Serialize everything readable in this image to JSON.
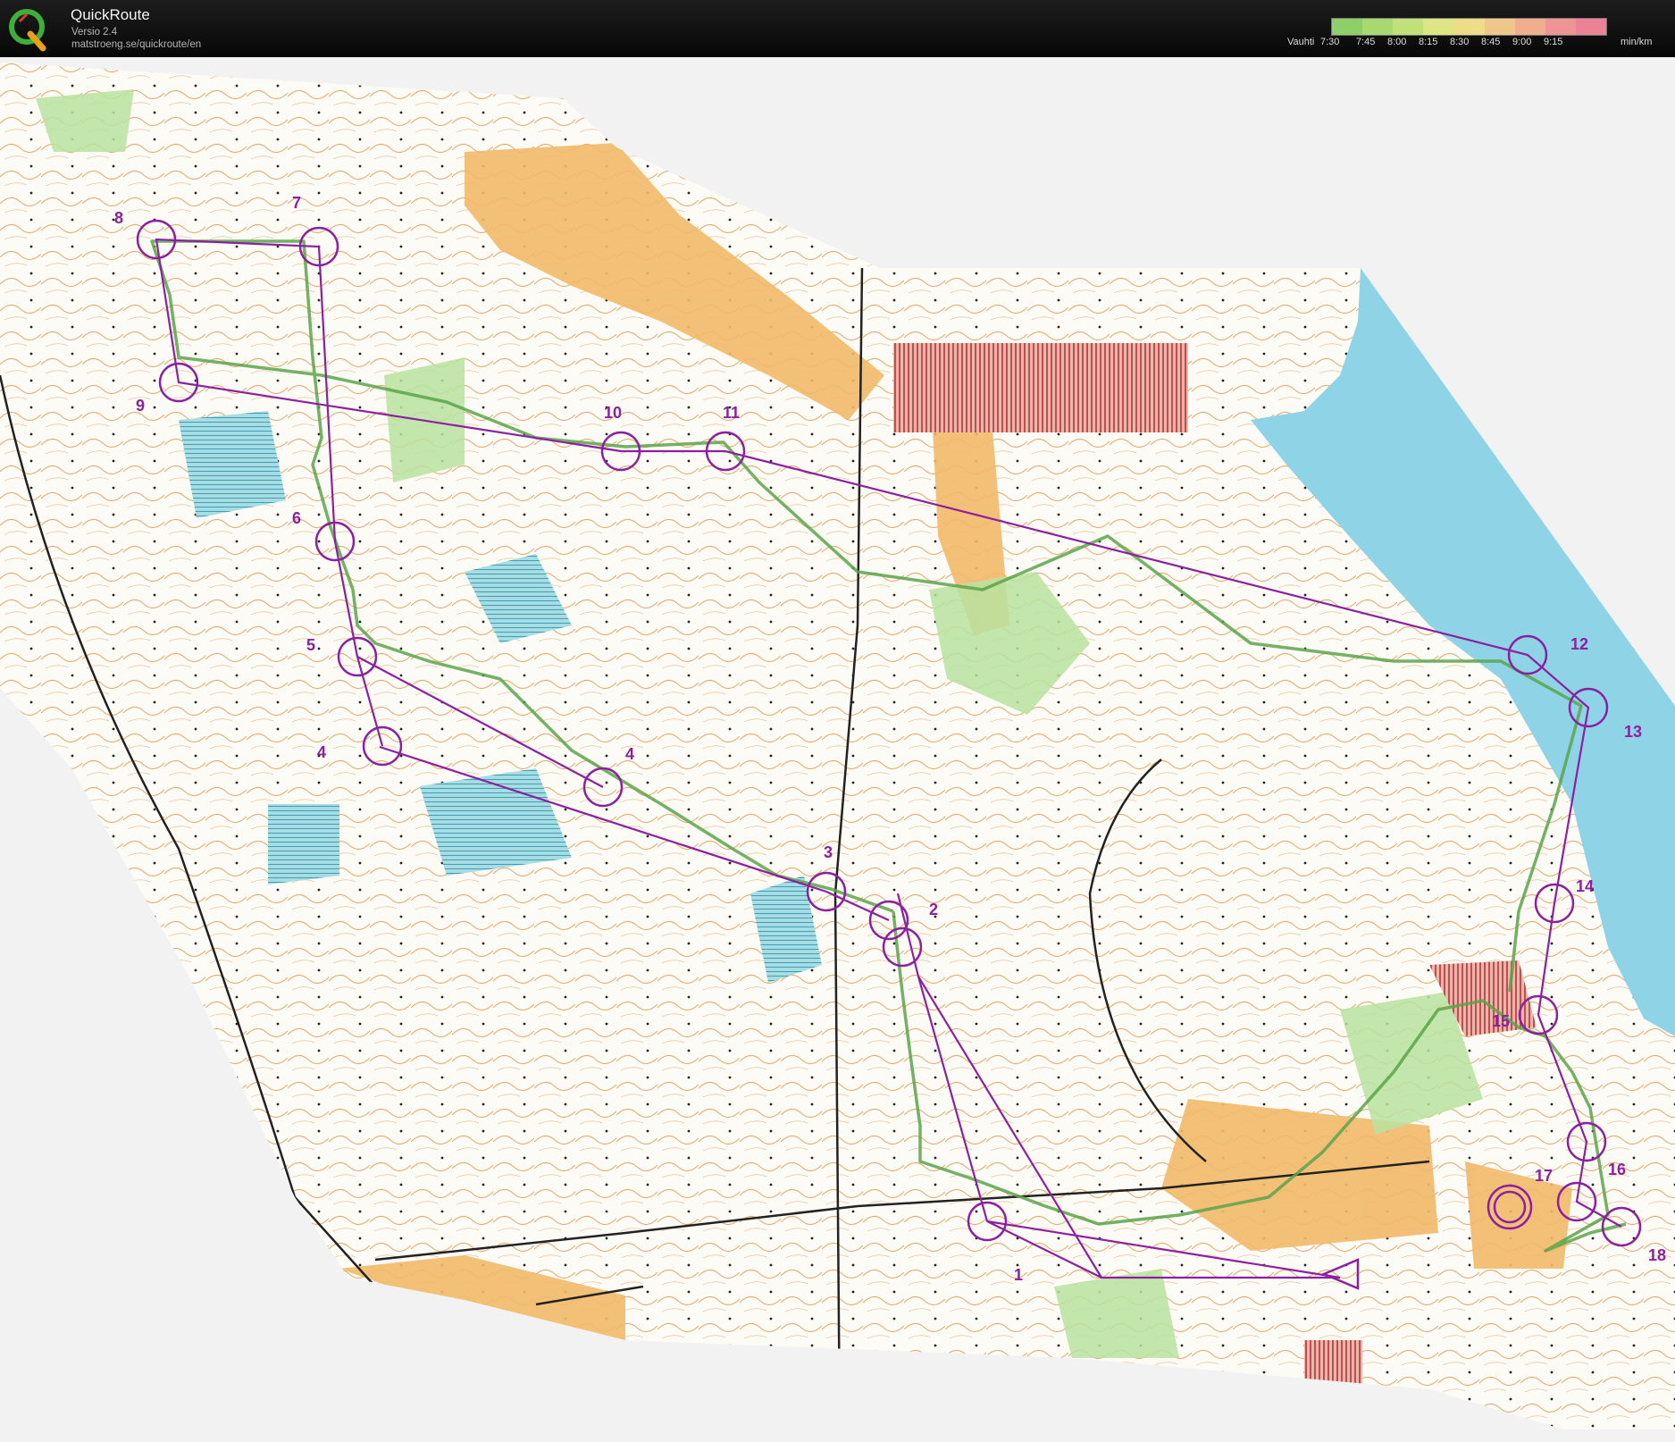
{
  "app": {
    "title": "QuickRoute",
    "version": "Versio 2.4",
    "url": "matstroeng.se/quickroute/en",
    "logo_icon": "quickroute-q-logo-icon"
  },
  "pace_legend": {
    "label": "Vauhti",
    "ticks": [
      "7:30",
      "7:45",
      "8:00",
      "8:15",
      "8:30",
      "8:45",
      "9:00",
      "9:15"
    ],
    "unit": "min/km",
    "colors": [
      "#8fcf6a",
      "#a8d870",
      "#c2e07a",
      "#dce684",
      "#ecde88",
      "#f0c78a",
      "#f0ae8e",
      "#ee9494",
      "#ec8296"
    ]
  },
  "map": {
    "course_color": "#8b20a0",
    "route_color": "#5aa34a",
    "water_color": "#8fd3e6",
    "open_land_color": "#f2b96a",
    "controls": [
      {
        "label": "1"
      },
      {
        "label": "2"
      },
      {
        "label": "3"
      },
      {
        "label": "4"
      },
      {
        "label": "4"
      },
      {
        "label": "5"
      },
      {
        "label": "6"
      },
      {
        "label": "7"
      },
      {
        "label": "8"
      },
      {
        "label": "9"
      },
      {
        "label": "10"
      },
      {
        "label": "11"
      },
      {
        "label": "12"
      },
      {
        "label": "13"
      },
      {
        "label": "14"
      },
      {
        "label": "15"
      },
      {
        "label": "16"
      },
      {
        "label": "17"
      },
      {
        "label": "18"
      }
    ]
  }
}
